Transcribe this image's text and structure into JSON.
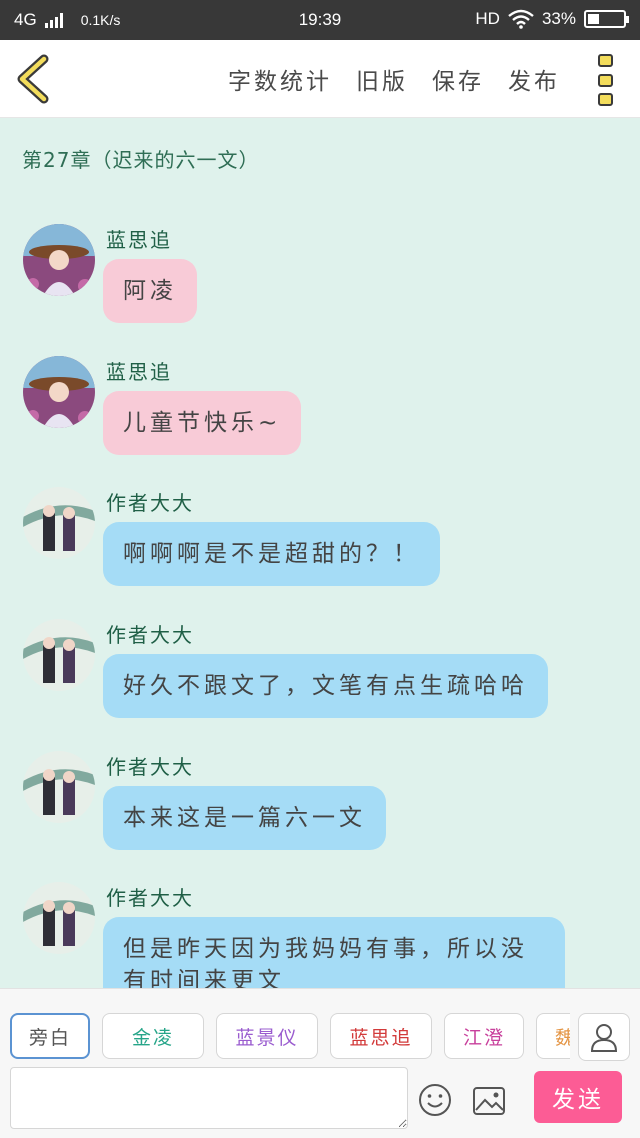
{
  "status_bar": {
    "network": "4G",
    "speed": "0.1K/s",
    "time": "19:39",
    "hd": "HD",
    "battery": "33%",
    "battery_level": 0.33
  },
  "toolbar": {
    "back_icon": "chevron-left-icon",
    "actions": [
      {
        "label": "字数统计"
      },
      {
        "label": "旧版"
      },
      {
        "label": "保存"
      },
      {
        "label": "发布"
      }
    ],
    "more_icon": "more-vertical-icon",
    "accent_color": "#f3dd5c"
  },
  "chat": {
    "chapter_title": "第27章（迟来的六一文）",
    "messages": [
      {
        "sender": "蓝思追",
        "text": "阿凌",
        "bubble_color": "#f8cbd7",
        "avatar": "lan-sizhui-avatar"
      },
      {
        "sender": "蓝思追",
        "text": "儿童节快乐~",
        "bubble_color": "#f8cbd7",
        "avatar": "lan-sizhui-avatar"
      },
      {
        "sender": "作者大大",
        "text": "啊啊啊是不是超甜的？！",
        "bubble_color": "#a5dcf6",
        "avatar": "author-avatar"
      },
      {
        "sender": "作者大大",
        "text": "好久不跟文了，文笔有点生疏哈哈",
        "bubble_color": "#a5dcf6",
        "avatar": "author-avatar"
      },
      {
        "sender": "作者大大",
        "text": "本来这是一篇六一文",
        "bubble_color": "#a5dcf6",
        "avatar": "author-avatar"
      },
      {
        "sender": "作者大大",
        "text": "但是昨天因为我妈妈有事，所以没有时间来更文",
        "bubble_color": "#a5dcf6",
        "avatar": "author-avatar"
      }
    ]
  },
  "bottom_panel": {
    "roles": [
      {
        "label": "旁白",
        "color": "#555555"
      },
      {
        "label": "金凌",
        "color": "#27a589"
      },
      {
        "label": "蓝景仪",
        "color": "#9a5ccf"
      },
      {
        "label": "蓝思追",
        "color": "#d23a3a"
      },
      {
        "label": "江澄",
        "color": "#c8409c"
      },
      {
        "label": "魏无",
        "color": "#e49545"
      }
    ],
    "role_add_icon": "person-icon",
    "input_value": "",
    "emoji_icon": "smiley-icon",
    "image_icon": "image-icon",
    "send_label": "发送",
    "send_color": "#fc5c95"
  }
}
